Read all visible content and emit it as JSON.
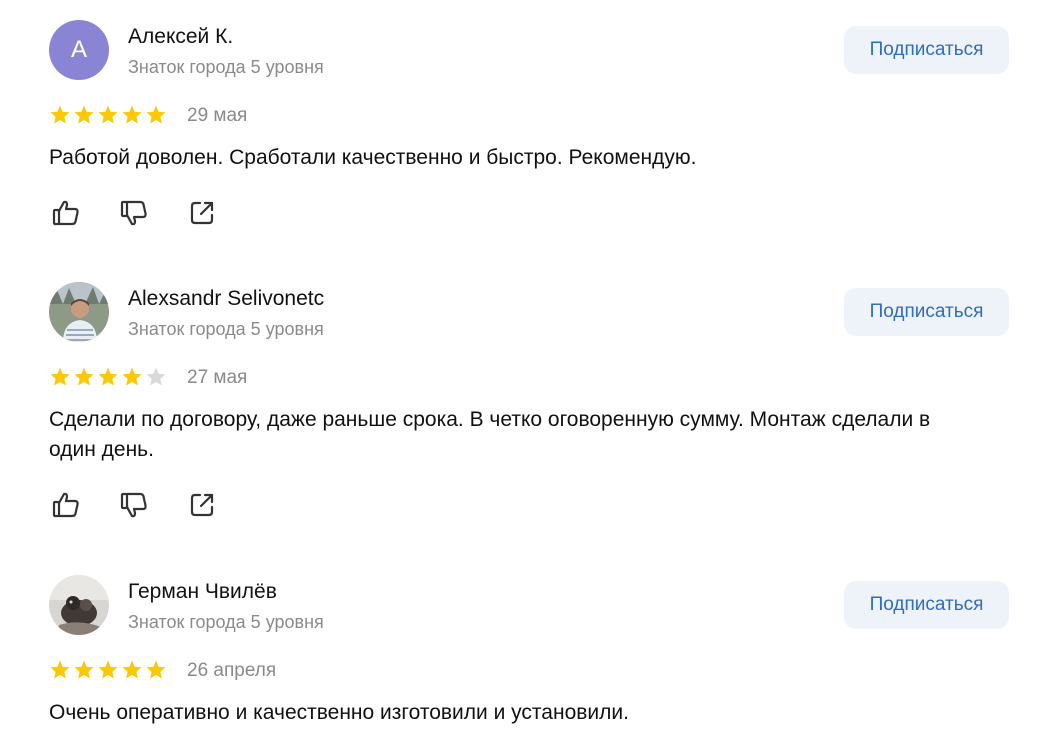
{
  "subscribe_label": "Подписаться",
  "colors": {
    "star_filled": "#fcc800",
    "star_empty": "#d9d9d9",
    "subscribe_bg": "#eef3fa",
    "subscribe_text": "#2f6cc6",
    "avatar_letter_bg": "#8a84d4"
  },
  "reviews": [
    {
      "author": "Алексей К.",
      "avatar_letter": "А",
      "level": "Знаток города 5 уровня",
      "rating": 5,
      "date": "29 мая",
      "text": "Работой доволен. Сработали качественно и быстро. Рекомендую."
    },
    {
      "author": "Alexsandr Selivonetc",
      "avatar_letter": "",
      "level": "Знаток города 5 уровня",
      "rating": 4,
      "date": "27 мая",
      "text": "Сделали по договору, даже раньше срока. В четко оговоренную сумму. Монтаж сделали в один день."
    },
    {
      "author": "Герман Чвилёв",
      "avatar_letter": "",
      "level": "Знаток города 5 уровня",
      "rating": 5,
      "date": "26 апреля",
      "text": "Очень оперативно и качественно изготовили и установили."
    }
  ],
  "icons": {
    "like": "thumbs-up-icon",
    "dislike": "thumbs-down-icon",
    "share": "share-icon"
  }
}
